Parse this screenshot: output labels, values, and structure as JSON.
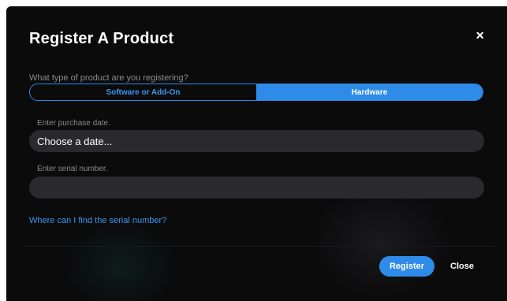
{
  "dialog": {
    "title": "Register A Product",
    "close_icon": "close-icon"
  },
  "product_type": {
    "question": "What type of product are you registering?",
    "options": [
      {
        "label": "Software or Add-On",
        "selected": false
      },
      {
        "label": "Hardware",
        "selected": true
      }
    ]
  },
  "purchase_date": {
    "label": "Enter purchase date.",
    "value": "Choose a date..."
  },
  "serial_number": {
    "label": "Enter serial number.",
    "value": ""
  },
  "help_link": "Where can I find the serial number?",
  "footer": {
    "register_label": "Register",
    "close_label": "Close"
  },
  "colors": {
    "background": "#0b0b0c",
    "accent": "#2f8be8",
    "field": "#2a2a2d",
    "muted_text": "#8b8b90"
  }
}
